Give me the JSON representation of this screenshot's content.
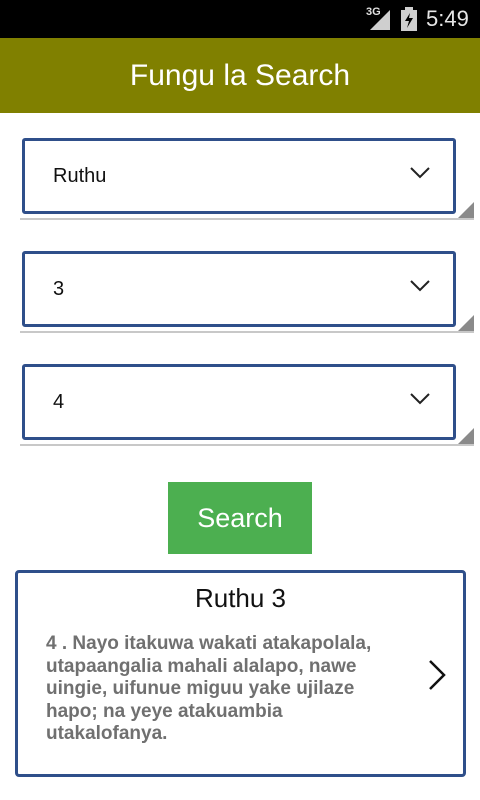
{
  "status_bar": {
    "network": "3G",
    "time": "5:49"
  },
  "header": {
    "title": "Fungu la Search"
  },
  "selectors": {
    "book": "Ruthu",
    "chapter": "3",
    "verse": "4"
  },
  "search_button": {
    "label": "Search"
  },
  "result": {
    "title": "Ruthu 3",
    "text": "4 . Nayo itakuwa wakati atakapolala, utapaangalia mahali alalapo, nawe uingie, uifunue miguu yake ujilaze hapo; na yeye atakuambia utakalofanya."
  },
  "colors": {
    "app_bar": "#808000",
    "button": "#4caf50",
    "border": "#2f4f8a"
  }
}
